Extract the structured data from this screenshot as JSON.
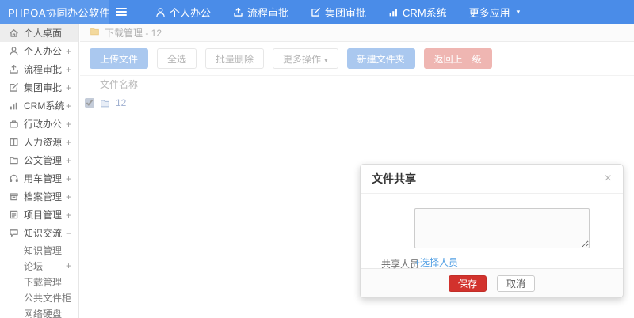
{
  "navbar": {
    "logo": "PHPOA协同办公软件",
    "items": [
      {
        "label": "个人办公",
        "icon": "user-icon"
      },
      {
        "label": "流程审批",
        "icon": "flow-icon"
      },
      {
        "label": "集团审批",
        "icon": "edit-icon"
      },
      {
        "label": "CRM系统",
        "icon": "chart-icon"
      },
      {
        "label": "更多应用",
        "icon": "caret-down-icon",
        "caret": "▾"
      }
    ]
  },
  "sidebar": {
    "items": [
      {
        "label": "个人桌面",
        "icon": "home-icon",
        "expander": ""
      },
      {
        "label": "个人办公",
        "icon": "user-icon",
        "expander": "+"
      },
      {
        "label": "流程审批",
        "icon": "flow-icon",
        "expander": "+"
      },
      {
        "label": "集团审批",
        "icon": "edit-icon",
        "expander": "+"
      },
      {
        "label": "CRM系统",
        "icon": "chart-icon",
        "expander": "+"
      },
      {
        "label": "行政办公",
        "icon": "briefcase-icon",
        "expander": "+"
      },
      {
        "label": "人力资源",
        "icon": "book-icon",
        "expander": "+"
      },
      {
        "label": "公文管理",
        "icon": "folder-icon",
        "expander": "+"
      },
      {
        "label": "用车管理",
        "icon": "headset-icon",
        "expander": "+"
      },
      {
        "label": "档案管理",
        "icon": "archive-icon",
        "expander": "+"
      },
      {
        "label": "项目管理",
        "icon": "project-icon",
        "expander": "+"
      },
      {
        "label": "知识交流",
        "icon": "chat-icon",
        "expander": "−"
      }
    ],
    "subitems": [
      {
        "label": "知识管理",
        "expander": ""
      },
      {
        "label": "论坛",
        "expander": "+"
      },
      {
        "label": "下载管理",
        "expander": ""
      },
      {
        "label": "公共文件柜",
        "expander": ""
      },
      {
        "label": "网络硬盘",
        "expander": ""
      }
    ]
  },
  "breadcrumb": {
    "label": "下载管理 - 12"
  },
  "toolbar": {
    "buttons": [
      {
        "label": "上传文件",
        "style": "primary"
      },
      {
        "label": "全选",
        "style": "default"
      },
      {
        "label": "批量删除",
        "style": "default"
      },
      {
        "label": "更多操作",
        "style": "default",
        "caret": "▾"
      },
      {
        "label": "新建文件夹",
        "style": "primary"
      },
      {
        "label": "返回上一级",
        "style": "danger"
      }
    ]
  },
  "table": {
    "header": "文件名称",
    "rows": [
      {
        "name": "12",
        "checked": true
      }
    ]
  },
  "modal": {
    "title": "文件共享",
    "close": "×",
    "label": "共享人员",
    "textarea_value": "",
    "link": "+选择人员",
    "save": "保存",
    "cancel": "取消"
  },
  "colors": {
    "navbar": "#4a8ce8",
    "navbar_logo": "#5c99ec",
    "save_button": "#d2322d",
    "link_blue": "#53a0e4",
    "primary_button_faded": "#aac8ef",
    "danger_button_faded": "#efb6b2"
  }
}
